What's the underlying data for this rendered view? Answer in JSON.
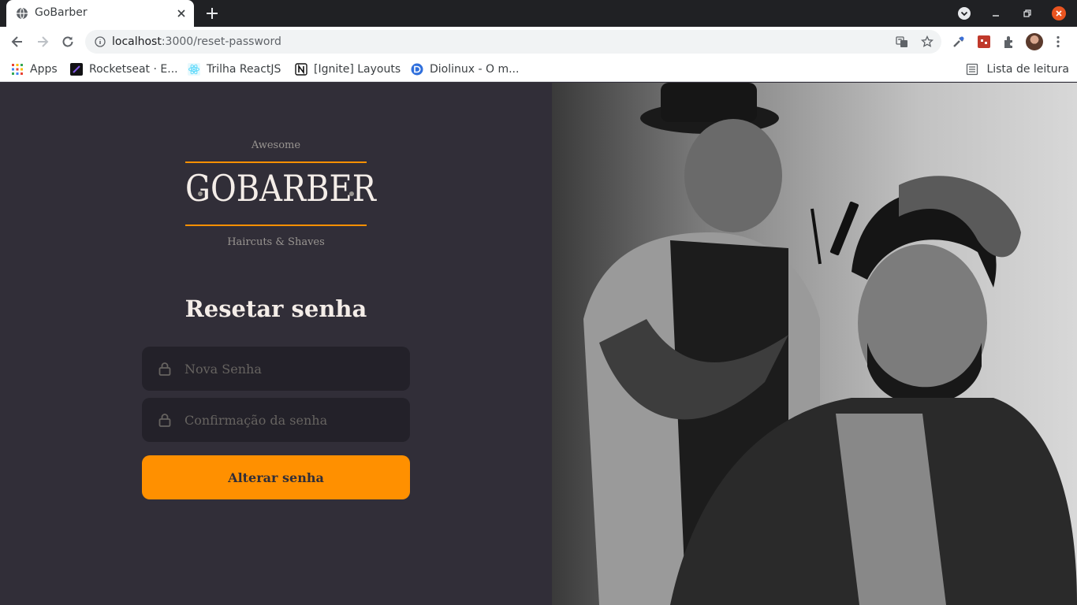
{
  "browser": {
    "tab": {
      "title": "GoBarber"
    },
    "address_bar": {
      "host": "localhost",
      "path": ":3000/reset-password"
    },
    "bookmarks": [
      {
        "label": "Apps",
        "icon": "apps-grid-icon"
      },
      {
        "label": "Rocketseat · E...",
        "icon": "rocketseat-icon"
      },
      {
        "label": "Trilha ReactJS",
        "icon": "react-icon"
      },
      {
        "label": "[Ignite] Layouts",
        "icon": "notion-icon"
      },
      {
        "label": "Diolinux - O m...",
        "icon": "diolinux-icon"
      }
    ],
    "reading_list": {
      "label": "Lista de leitura",
      "icon": "reading-list-icon"
    }
  },
  "page": {
    "logo": {
      "top_text": "Awesome",
      "name": "GOBARBER",
      "bottom_text": "Haircuts & Shaves"
    },
    "form": {
      "title": "Resetar senha",
      "new_password_placeholder": "Nova Senha",
      "confirm_password_placeholder": "Confirmação da senha",
      "submit_label": "Alterar senha"
    },
    "image": {
      "description_icon": "barber-photo"
    }
  },
  "colors": {
    "background": "#312e38",
    "input_background": "#232129",
    "accent": "#ff9000",
    "text_light": "#f4ede8",
    "text_muted": "#999591",
    "placeholder": "#666360"
  }
}
